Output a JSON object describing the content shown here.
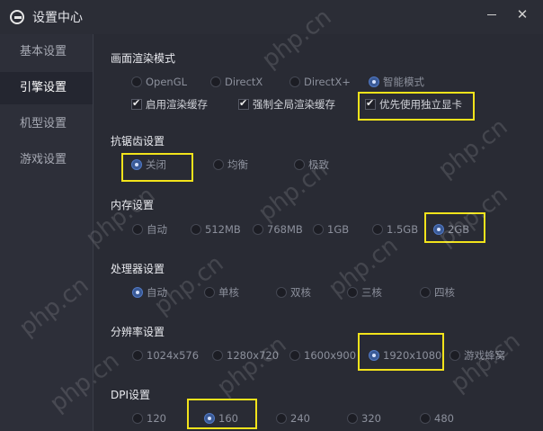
{
  "window": {
    "title": "设置中心",
    "close_glyph": "✕"
  },
  "sidebar": {
    "items": [
      {
        "label": "基本设置"
      },
      {
        "label": "引擎设置"
      },
      {
        "label": "机型设置"
      },
      {
        "label": "游戏设置"
      }
    ],
    "active_index": 1
  },
  "render": {
    "title": "画面渲染模式",
    "options": [
      "OpenGL",
      "DirectX",
      "DirectX+",
      "智能模式"
    ],
    "selected": "智能模式",
    "checks": [
      "启用渲染缓存",
      "强制全局渲染缓存",
      "优先使用独立显卡"
    ]
  },
  "antialias": {
    "title": "抗锯齿设置",
    "options": [
      "关闭",
      "均衡",
      "极致"
    ],
    "selected": "关闭"
  },
  "memory": {
    "title": "内存设置",
    "options": [
      "自动",
      "512MB",
      "768MB",
      "1GB",
      "1.5GB",
      "2GB"
    ],
    "selected": "2GB"
  },
  "cpu": {
    "title": "处理器设置",
    "options": [
      "自动",
      "单核",
      "双核",
      "三核",
      "四核"
    ],
    "selected": "自动"
  },
  "resolution": {
    "title": "分辨率设置",
    "options": [
      "1024x576",
      "1280x720",
      "1600x900",
      "1920x1080",
      "游戏蜂窝"
    ],
    "selected": "1920x1080"
  },
  "dpi": {
    "title": "DPI设置",
    "options": [
      "120",
      "160",
      "240",
      "320",
      "480"
    ],
    "selected": "160"
  },
  "watermark": "php.cn",
  "colors": {
    "highlight": "#f2e31b",
    "accent": "#5078c4",
    "background": "#292b34"
  }
}
